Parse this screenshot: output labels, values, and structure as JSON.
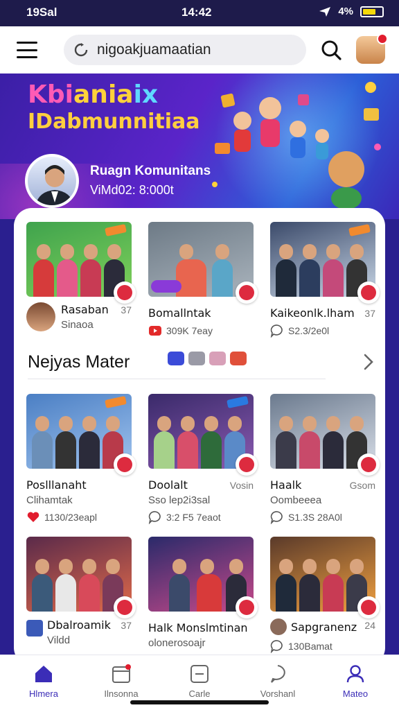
{
  "status_bar": {
    "carrier_time": "19Sal",
    "clock": "14:42",
    "battery": "4%"
  },
  "search": {
    "value": "nigoakjuamaatian"
  },
  "hero": {
    "brand_line1": [
      "Kbi",
      "ania",
      "ix"
    ],
    "brand_line2": "IDabmunnitiaa",
    "host_name": "Ruagn Komunitans",
    "host_sub": "ViMd02: 8:000t"
  },
  "featured": [
    {
      "title": "Rasaban",
      "side": "37",
      "sub": "Sinaoa",
      "meta": "",
      "thumb": [
        "#3fa34d",
        "#7fd05a"
      ],
      "people": [
        "#d63b3b",
        "#e45a8a",
        "#c83b54",
        "#2b2b3a"
      ]
    },
    {
      "title": "Bomallntak",
      "side": "",
      "sub": "",
      "meta": "309K 7eay",
      "thumb": [
        "#6d7a86",
        "#aab4bd"
      ],
      "people": [
        "#e8654f",
        "#5aa6c8"
      ]
    },
    {
      "title": "Kaikeonlk.lham",
      "side": "37",
      "sub": "",
      "meta": "S2.3/2e0l",
      "thumb": [
        "#3b4a6a",
        "#c8d6e6"
      ],
      "people": [
        "#1f2a3a",
        "#2c3d5e",
        "#c44a7a",
        "#333"
      ]
    }
  ],
  "section": {
    "title": "Nejyas Mater"
  },
  "grid": [
    {
      "title": "Poslllanaht",
      "side": "",
      "sub": "Clihamtak",
      "meta": "1130/23eapl",
      "meta_icon": "heart",
      "thumb": [
        "#4b7fc4",
        "#9fc3ee"
      ],
      "people": [
        "#6b8fb8",
        "#333",
        "#2b2b3a",
        "#b83a4a"
      ]
    },
    {
      "title": "Doolalt",
      "side": "Vosin",
      "sub": "Sso lep2i3sal",
      "meta": "3:2 F5 7eaot",
      "meta_icon": "comment",
      "thumb": [
        "#3a2a6a",
        "#8a5ab0"
      ],
      "people": [
        "#a6d18a",
        "#d84f6a",
        "#2e6b3a",
        "#5a8ac8"
      ]
    },
    {
      "title": "Haalk",
      "side": "Gsom",
      "sub": "Oombeeea",
      "meta": "S1.3S 28A0l",
      "meta_icon": "comment",
      "thumb": [
        "#6b7a8e",
        "#d8dee8"
      ],
      "people": [
        "#3b3b4a",
        "#c84a6a",
        "#2b2b3a",
        "#333"
      ]
    },
    {
      "title": "Dbalroamik",
      "side": "37",
      "sub": "Vildd",
      "meta": "",
      "meta_icon": "",
      "thumb": [
        "#5a2a4a",
        "#e06a4a"
      ],
      "people": [
        "#3b5a7a",
        "#e8e8e8",
        "#d84a5a",
        "#7a3a5a"
      ]
    },
    {
      "title": "Halk Monslmtinan",
      "side": "",
      "sub": "olonerosoajr",
      "meta": "",
      "meta_icon": "",
      "thumb": [
        "#2a2a6a",
        "#c84a8a"
      ],
      "people": [
        "#3b4a6a",
        "#d83a3a",
        "#2b2b3a"
      ]
    },
    {
      "title": "Sapgranenz",
      "side": "24",
      "sub": "",
      "meta": "130Bamat",
      "meta_icon": "comment",
      "thumb": [
        "#5a3a2a",
        "#f0a040"
      ],
      "people": [
        "#1f2a3a",
        "#2b2b3a",
        "#c83b54",
        "#3b3b4a"
      ]
    }
  ],
  "nav": [
    {
      "label": "Hlmera",
      "icon": "home-icon",
      "active": true
    },
    {
      "label": "Ilnsonna",
      "icon": "calendar-icon",
      "active": false
    },
    {
      "label": "Carle",
      "icon": "square-minus-icon",
      "active": false
    },
    {
      "label": "Vorshanl",
      "icon": "chat-bubble-icon",
      "active": false
    },
    {
      "label": "Mateo",
      "icon": "user-icon",
      "active": true
    }
  ],
  "colors": {
    "accent": "#3b2db7",
    "badge": "#dd2b3f",
    "header_bg": "#1e1b4b"
  }
}
